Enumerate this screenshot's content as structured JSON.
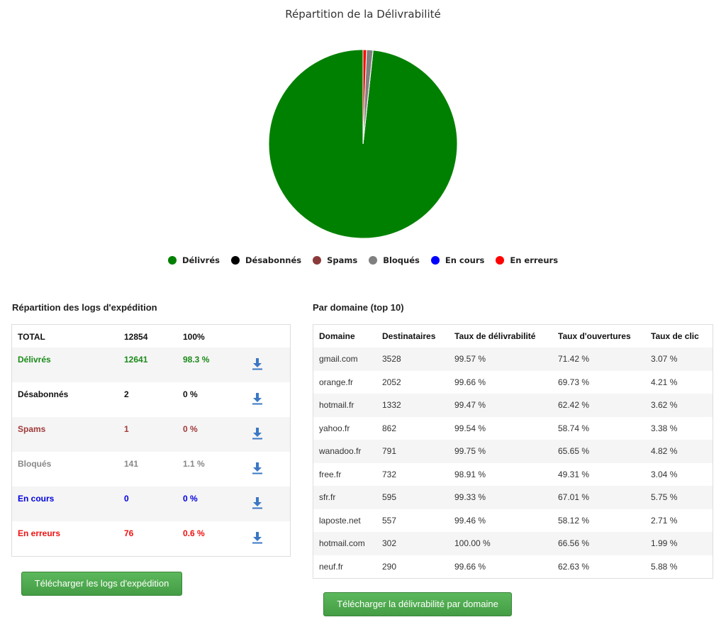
{
  "chart_data": {
    "type": "pie",
    "title": "Répartition de la Délivrabilité",
    "legend_position": "bottom",
    "categories": [
      "Délivrés",
      "Désabonnés",
      "Spams",
      "Bloqués",
      "En cours",
      "En erreurs"
    ],
    "values": [
      12641,
      2,
      1,
      141,
      0,
      76
    ],
    "colors": [
      "#008000",
      "#000000",
      "#8b3a3a",
      "#808080",
      "#0000ff",
      "#ff0000"
    ]
  },
  "logs": {
    "title": "Répartition des logs d'expédition",
    "header": {
      "label": "TOTAL",
      "count": "12854",
      "pct": "100%"
    },
    "rows": [
      {
        "label": "Délivrés",
        "count": "12641",
        "pct": "98.3 %",
        "color": "#1a8a1a"
      },
      {
        "label": "Désabonnés",
        "count": "2",
        "pct": "0 %",
        "color": "#111111"
      },
      {
        "label": "Spams",
        "count": "1",
        "pct": "0 %",
        "color": "#a03a3a"
      },
      {
        "label": "Bloqués",
        "count": "141",
        "pct": "1.1 %",
        "color": "#888888"
      },
      {
        "label": "En cours",
        "count": "0",
        "pct": "0 %",
        "color": "#0000dd"
      },
      {
        "label": "En erreurs",
        "count": "76",
        "pct": "0.6 %",
        "color": "#ee1111"
      }
    ],
    "download_icon": "download-icon",
    "button_label": "Télécharger les logs d'expédition"
  },
  "domains": {
    "title": "Par domaine (top 10)",
    "headers": [
      "Domaine",
      "Destinataires",
      "Taux de délivrabilité",
      "Taux d'ouvertures",
      "Taux de clic"
    ],
    "rows": [
      [
        "gmail.com",
        "3528",
        "99.57 %",
        "71.42 %",
        "3.07 %"
      ],
      [
        "orange.fr",
        "2052",
        "99.66 %",
        "69.73 %",
        "4.21 %"
      ],
      [
        "hotmail.fr",
        "1332",
        "99.47 %",
        "62.42 %",
        "3.62 %"
      ],
      [
        "yahoo.fr",
        "862",
        "99.54 %",
        "58.74 %",
        "3.38 %"
      ],
      [
        "wanadoo.fr",
        "791",
        "99.75 %",
        "65.65 %",
        "4.82 %"
      ],
      [
        "free.fr",
        "732",
        "98.91 %",
        "49.31 %",
        "3.04 %"
      ],
      [
        "sfr.fr",
        "595",
        "99.33 %",
        "67.01 %",
        "5.75 %"
      ],
      [
        "laposte.net",
        "557",
        "99.46 %",
        "58.12 %",
        "2.71 %"
      ],
      [
        "hotmail.com",
        "302",
        "100.00 %",
        "66.56 %",
        "1.99 %"
      ],
      [
        "neuf.fr",
        "290",
        "99.66 %",
        "62.63 %",
        "5.88 %"
      ]
    ],
    "button_label": "Télécharger la délivrabilité par domaine"
  }
}
